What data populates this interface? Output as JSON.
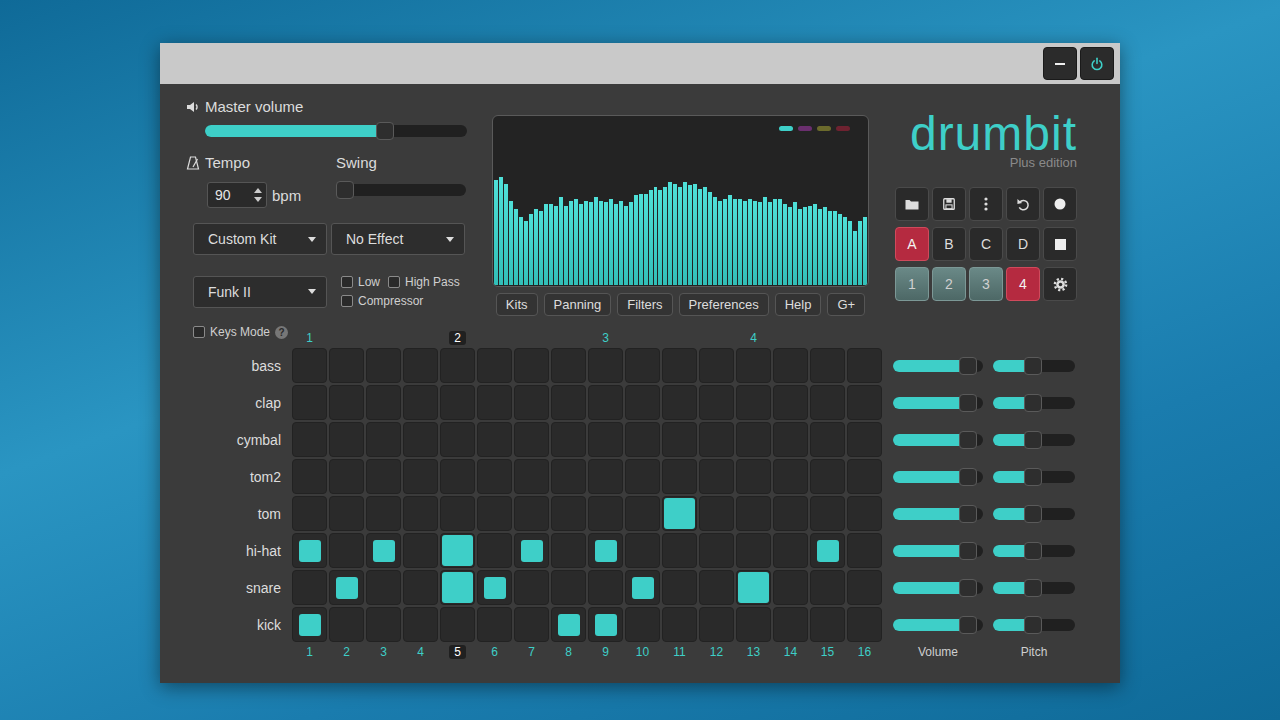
{
  "master_volume": {
    "label": "Master volume",
    "level": 0.7
  },
  "tempo": {
    "label": "Tempo",
    "value": "90",
    "unit": "bpm"
  },
  "swing": {
    "label": "Swing",
    "level": 0
  },
  "dropdowns": [
    {
      "value": "Custom Kit"
    },
    {
      "value": "No Effect"
    },
    {
      "value": "Funk II"
    }
  ],
  "filters": [
    {
      "label": "Low",
      "checked": false
    },
    {
      "label": "High Pass",
      "checked": false
    },
    {
      "label": "Compressor",
      "checked": false
    }
  ],
  "keys_mode": {
    "label": "Keys Mode",
    "checked": false,
    "help": "?"
  },
  "visualizer": {
    "legend": [
      {
        "color": "#3ecfc8"
      },
      {
        "color": "#6a2f6e"
      },
      {
        "color": "#6b6a2c"
      },
      {
        "color": "#6e2230"
      }
    ],
    "values": [
      62,
      64,
      60,
      50,
      45,
      40,
      38,
      42,
      45,
      44,
      48,
      48,
      47,
      52,
      47,
      50,
      51,
      48,
      50,
      49,
      52,
      50,
      49,
      51,
      48,
      50,
      47,
      49,
      53,
      54,
      54,
      56,
      58,
      56,
      58,
      61,
      60,
      58,
      61,
      59,
      60,
      57,
      58,
      55,
      52,
      50,
      51,
      53,
      51,
      51,
      50,
      51,
      50,
      49,
      52,
      49,
      51,
      51,
      48,
      46,
      49,
      45,
      46,
      47,
      48,
      45,
      46,
      44,
      44,
      42,
      40,
      38,
      32,
      38,
      40
    ]
  },
  "panel_buttons": [
    "Kits",
    "Panning",
    "Filters",
    "Preferences",
    "Help",
    "G+"
  ],
  "logo": {
    "name": "drumbit",
    "edition": "Plus edition"
  },
  "patterns": [
    {
      "label": "A",
      "selected": true,
      "filled": true
    },
    {
      "label": "B",
      "selected": false,
      "filled": false
    },
    {
      "label": "C",
      "selected": false,
      "filled": false
    },
    {
      "label": "D",
      "selected": false,
      "filled": false
    }
  ],
  "variations": [
    {
      "label": "1",
      "selected": false,
      "filled": true
    },
    {
      "label": "2",
      "selected": false,
      "filled": true
    },
    {
      "label": "3",
      "selected": false,
      "filled": true
    },
    {
      "label": "4",
      "selected": true,
      "filled": true
    }
  ],
  "beats": [
    {
      "label": "1",
      "current": false
    },
    {
      "label": "2",
      "current": true
    },
    {
      "label": "3",
      "current": false
    },
    {
      "label": "4",
      "current": false
    }
  ],
  "steps": [
    {
      "label": "1",
      "current": false
    },
    {
      "label": "2",
      "current": false
    },
    {
      "label": "3",
      "current": false
    },
    {
      "label": "4",
      "current": false
    },
    {
      "label": "5",
      "current": true
    },
    {
      "label": "6",
      "current": false
    },
    {
      "label": "7",
      "current": false
    },
    {
      "label": "8",
      "current": false
    },
    {
      "label": "9",
      "current": false
    },
    {
      "label": "10",
      "current": false
    },
    {
      "label": "11",
      "current": false
    },
    {
      "label": "12",
      "current": false
    },
    {
      "label": "13",
      "current": false
    },
    {
      "label": "14",
      "current": false
    },
    {
      "label": "15",
      "current": false
    },
    {
      "label": "16",
      "current": false
    }
  ],
  "tracks": [
    {
      "name": "bass",
      "steps": [
        0,
        0,
        0,
        0,
        0,
        0,
        0,
        0,
        0,
        0,
        0,
        0,
        0,
        0,
        0,
        0
      ],
      "volume": 0.91,
      "pitch": 0.48
    },
    {
      "name": "clap",
      "steps": [
        0,
        0,
        0,
        0,
        0,
        0,
        0,
        0,
        0,
        0,
        0,
        0,
        0,
        0,
        0,
        0
      ],
      "volume": 0.91,
      "pitch": 0.48
    },
    {
      "name": "cymbal",
      "steps": [
        0,
        0,
        0,
        0,
        0,
        0,
        0,
        0,
        0,
        0,
        0,
        0,
        0,
        0,
        0,
        0
      ],
      "volume": 0.91,
      "pitch": 0.48
    },
    {
      "name": "tom2",
      "steps": [
        0,
        0,
        0,
        0,
        0,
        0,
        0,
        0,
        0,
        0,
        0,
        0,
        0,
        0,
        0,
        0
      ],
      "volume": 0.91,
      "pitch": 0.48
    },
    {
      "name": "tom",
      "steps": [
        0,
        0,
        0,
        0,
        0,
        0,
        0,
        0,
        0,
        0,
        2,
        0,
        0,
        0,
        0,
        0
      ],
      "volume": 0.91,
      "pitch": 0.48
    },
    {
      "name": "hi-hat",
      "steps": [
        1,
        0,
        1,
        0,
        1,
        0,
        1,
        0,
        1,
        0,
        0,
        0,
        0,
        0,
        1,
        0
      ],
      "volume": 0.91,
      "pitch": 0.48
    },
    {
      "name": "snare",
      "steps": [
        0,
        1,
        0,
        0,
        1,
        1,
        0,
        0,
        0,
        1,
        0,
        0,
        2,
        0,
        0,
        0
      ],
      "volume": 0.91,
      "pitch": 0.48
    },
    {
      "name": "kick",
      "steps": [
        1,
        0,
        0,
        0,
        0,
        0,
        0,
        1,
        1,
        0,
        0,
        0,
        0,
        0,
        0,
        0
      ],
      "volume": 0.91,
      "pitch": 0.48
    }
  ],
  "columns": {
    "volume": "Volume",
    "pitch": "Pitch"
  }
}
